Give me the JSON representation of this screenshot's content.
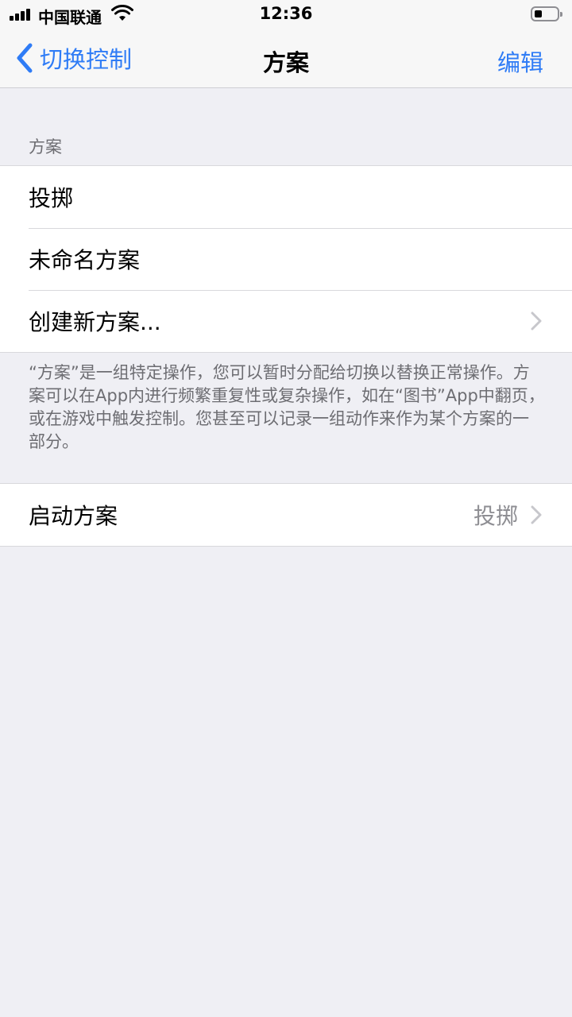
{
  "status_bar": {
    "carrier": "中国联通",
    "time": "12:36"
  },
  "nav": {
    "back_label": "切换控制",
    "title": "方案",
    "edit_label": "编辑"
  },
  "section": {
    "header": "方案",
    "items": [
      {
        "label": "投掷"
      },
      {
        "label": "未命名方案"
      },
      {
        "label": "创建新方案..."
      }
    ],
    "footer": "“方案”是一组特定操作，您可以暂时分配给切换以替换正常操作。方案可以在App内进行频繁重复性或复杂操作，如在“图书”App中翻页，或在游戏中触发控制。您甚至可以记录一组动作来作为某个方案的一部分。"
  },
  "launch": {
    "label": "启动方案",
    "value": "投掷"
  },
  "colors": {
    "accent": "#2f7cf6",
    "background": "#efeff4"
  }
}
